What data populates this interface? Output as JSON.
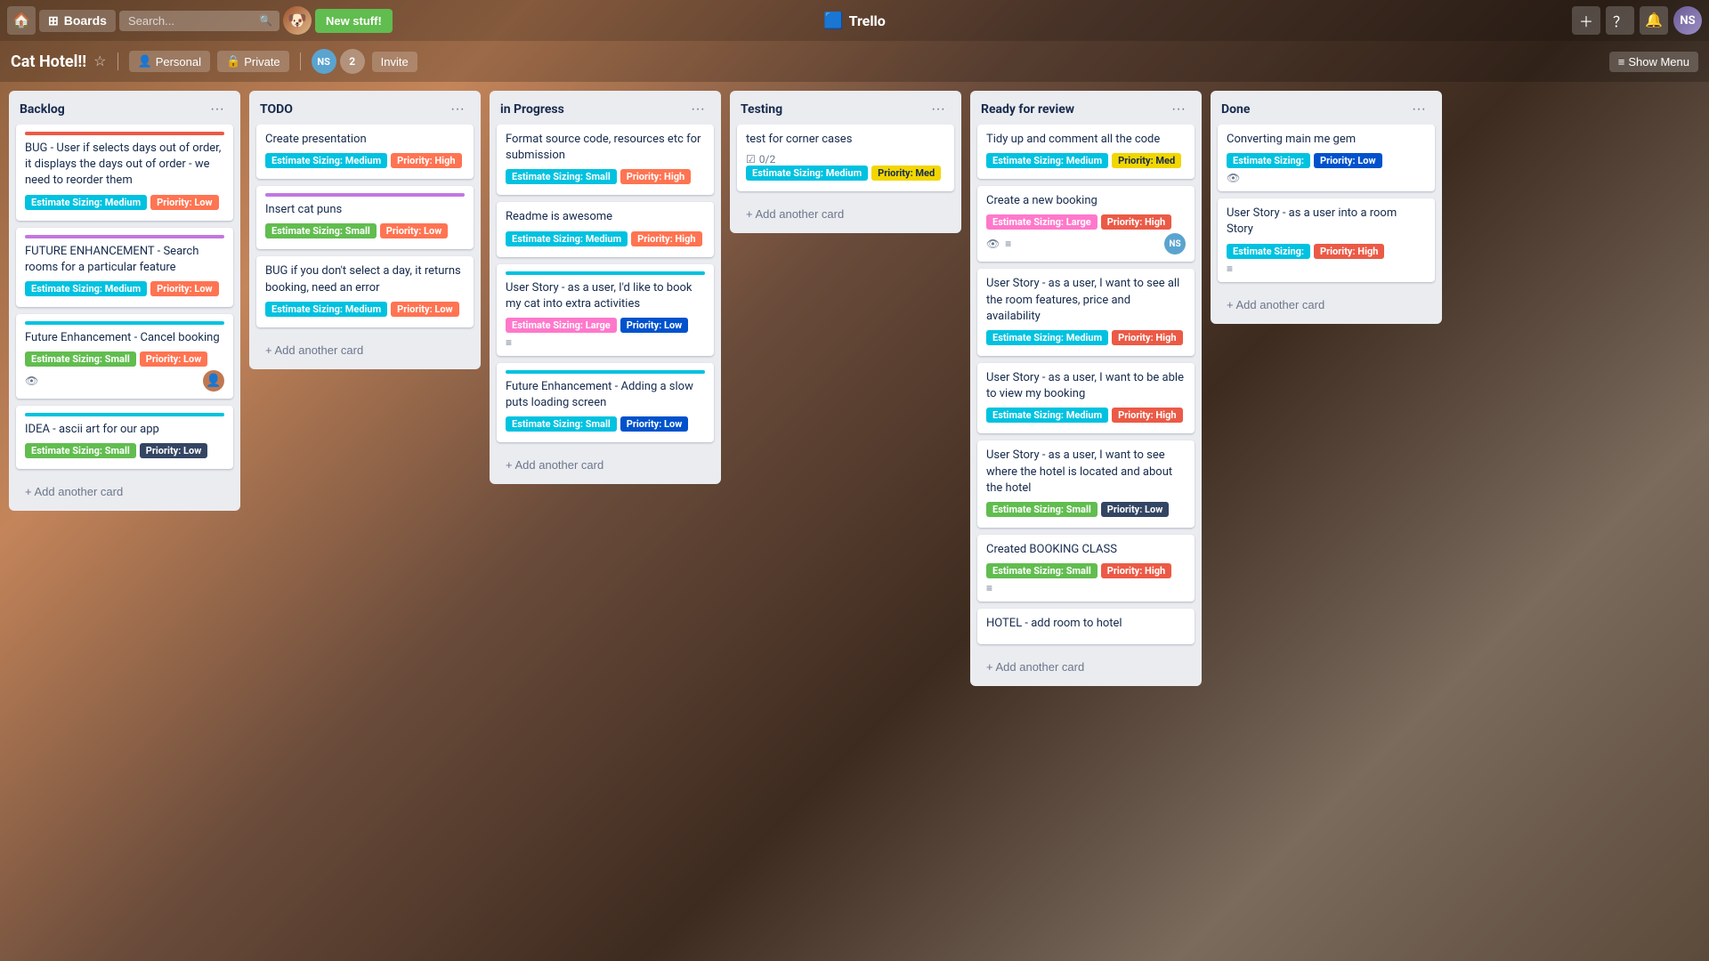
{
  "nav": {
    "boards_label": "Boards",
    "search_placeholder": "Search...",
    "new_stuff_label": "New stuff!",
    "trello_logo": "🟦 Trello",
    "show_menu_label": "Show Menu"
  },
  "board": {
    "title": "Cat Hotel!!",
    "visibility_personal": "Personal",
    "visibility_private": "Private",
    "team_initials": "NS",
    "team_count": "2",
    "invite_label": "Invite"
  },
  "columns": [
    {
      "id": "backlog",
      "title": "Backlog",
      "cards": [
        {
          "id": "b1",
          "color_bar": "#eb5a46",
          "title": "BUG - User if selects days out of order, it displays the days out of order - we need to reorder them",
          "badges": [
            {
              "label": "Estimate Sizing: Medium",
              "color": "cyan"
            },
            {
              "label": "Priority: Low",
              "color": "orange"
            }
          ],
          "icons": [],
          "avatar": null
        },
        {
          "id": "b2",
          "color_bar": "#c377e0",
          "title": "FUTURE ENHANCEMENT - Search rooms for a particular feature",
          "badges": [
            {
              "label": "Estimate Sizing: Medium",
              "color": "cyan"
            },
            {
              "label": "Priority: Low",
              "color": "orange"
            }
          ],
          "icons": [],
          "avatar": null
        },
        {
          "id": "b3",
          "color_bar": "#00c2e0",
          "title": "Future Enhancement - Cancel booking",
          "badges": [
            {
              "label": "Estimate Sizing: Small",
              "color": "green"
            },
            {
              "label": "Priority: Low",
              "color": "orange"
            }
          ],
          "icons": [
            "eye"
          ],
          "avatar": "user"
        },
        {
          "id": "b4",
          "color_bar": "#00c2e0",
          "title": "IDEA - ascii art for our app",
          "badges": [
            {
              "label": "Estimate Sizing: Small",
              "color": "green"
            },
            {
              "label": "Priority: Low",
              "color": "navy"
            }
          ],
          "icons": [],
          "avatar": null
        }
      ]
    },
    {
      "id": "todo",
      "title": "TODO",
      "cards": [
        {
          "id": "t1",
          "color_bar": null,
          "title": "Create presentation",
          "badges": [
            {
              "label": "Estimate Sizing: Medium",
              "color": "cyan"
            },
            {
              "label": "Priority: High",
              "color": "orange"
            }
          ],
          "icons": [],
          "avatar": null
        },
        {
          "id": "t2",
          "color_bar": "#c377e0",
          "title": "Insert cat puns",
          "badges": [
            {
              "label": "Estimate Sizing: Small",
              "color": "green"
            },
            {
              "label": "Priority: Low",
              "color": "orange"
            }
          ],
          "icons": [],
          "avatar": null
        },
        {
          "id": "t3",
          "color_bar": null,
          "title": "BUG if you don't select a day, it returns booking, need an error",
          "badges": [
            {
              "label": "Estimate Sizing: Medium",
              "color": "cyan"
            },
            {
              "label": "Priority: Low",
              "color": "orange"
            }
          ],
          "icons": [],
          "avatar": null
        }
      ]
    },
    {
      "id": "in-progress",
      "title": "in Progress",
      "cards": [
        {
          "id": "p1",
          "color_bar": null,
          "title": "Format source code, resources etc for submission",
          "badges": [
            {
              "label": "Estimate Sizing: Small",
              "color": "cyan"
            },
            {
              "label": "Priority: High",
              "color": "orange"
            }
          ],
          "icons": [],
          "avatar": null
        },
        {
          "id": "p2",
          "color_bar": null,
          "title": "Readme is awesome",
          "badges": [
            {
              "label": "Estimate Sizing: Medium",
              "color": "cyan"
            },
            {
              "label": "Priority: High",
              "color": "orange"
            }
          ],
          "icons": [],
          "avatar": null
        },
        {
          "id": "p3",
          "color_bar": "#00c2e0",
          "title": "User Story - as a user, I'd like to book my cat into extra activities",
          "badges": [
            {
              "label": "Estimate Sizing: Large",
              "color": "pink"
            },
            {
              "label": "Priority: Low",
              "color": "dark-blue"
            }
          ],
          "icons": [
            "list"
          ],
          "avatar": null
        },
        {
          "id": "p4",
          "color_bar": "#00c2e0",
          "title": "Future Enhancement - Adding a slow puts loading screen",
          "badges": [
            {
              "label": "Estimate Sizing: Small",
              "color": "cyan"
            },
            {
              "label": "Priority: Low",
              "color": "dark-blue"
            }
          ],
          "icons": [],
          "avatar": null
        }
      ]
    },
    {
      "id": "testing",
      "title": "Testing",
      "cards": [
        {
          "id": "te1",
          "color_bar": null,
          "title": "test for corner cases",
          "checklist": "0/2",
          "badges": [
            {
              "label": "Estimate Sizing: Medium",
              "color": "cyan"
            },
            {
              "label": "Priority: Med",
              "color": "yellow"
            }
          ],
          "icons": [],
          "avatar": null
        }
      ]
    },
    {
      "id": "ready-for-review",
      "title": "Ready for review",
      "cards": [
        {
          "id": "r1",
          "color_bar": null,
          "title": "Tidy up and comment all the code",
          "badges": [
            {
              "label": "Estimate Sizing: Medium",
              "color": "cyan"
            },
            {
              "label": "Priority: Med",
              "color": "yellow"
            }
          ],
          "icons": [],
          "avatar": null
        },
        {
          "id": "r2",
          "color_bar": null,
          "title": "Create a new booking",
          "badges": [
            {
              "label": "Estimate Sizing: Large",
              "color": "pink"
            },
            {
              "label": "Priority: High",
              "color": "red"
            }
          ],
          "icons": [
            "eye",
            "list"
          ],
          "avatar": "ns"
        },
        {
          "id": "r3",
          "color_bar": null,
          "title": "User Story - as a user, I want to see all the room features, price and availability",
          "badges": [
            {
              "label": "Estimate Sizing: Medium",
              "color": "cyan"
            },
            {
              "label": "Priority: High",
              "color": "red"
            }
          ],
          "icons": [],
          "avatar": null
        },
        {
          "id": "r4",
          "color_bar": null,
          "title": "User Story - as a user, I want to be able to view my booking",
          "badges": [
            {
              "label": "Estimate Sizing: Medium",
              "color": "cyan"
            },
            {
              "label": "Priority: High",
              "color": "red"
            }
          ],
          "icons": [],
          "avatar": null
        },
        {
          "id": "r5",
          "color_bar": null,
          "title": "User Story - as a user, I want to see where the hotel is located and about the hotel",
          "badges": [
            {
              "label": "Estimate Sizing: Small",
              "color": "green"
            },
            {
              "label": "Priority: Low",
              "color": "navy"
            }
          ],
          "icons": [],
          "avatar": null
        },
        {
          "id": "r6",
          "color_bar": null,
          "title": "Created BOOKING CLASS",
          "badges": [
            {
              "label": "Estimate Sizing: Small",
              "color": "green"
            },
            {
              "label": "Priority: High",
              "color": "red"
            }
          ],
          "icons": [
            "list"
          ],
          "avatar": null
        },
        {
          "id": "r7",
          "color_bar": null,
          "title": "HOTEL - add room to hotel",
          "badges": [],
          "icons": [],
          "avatar": null
        }
      ]
    },
    {
      "id": "done",
      "title": "Done",
      "cards": [
        {
          "id": "d1",
          "color_bar": null,
          "title": "Converting main me gem",
          "badges": [
            {
              "label": "Estimate Sizing:",
              "color": "cyan"
            },
            {
              "label": "Priority: Low",
              "color": "dark-blue"
            }
          ],
          "icons": [
            "eye"
          ],
          "avatar": null
        },
        {
          "id": "d2",
          "color_bar": null,
          "title": "User Story - as a user into a room Story",
          "badges": [
            {
              "label": "Estimate Sizing:",
              "color": "cyan"
            },
            {
              "label": "Priority: High",
              "color": "red"
            }
          ],
          "icons": [
            "list"
          ],
          "avatar": null
        }
      ]
    }
  ],
  "add_card_label": "+ Add another card",
  "colors": {
    "cyan": "#00c2e0",
    "orange": "#ff7452",
    "green": "#61bd4f",
    "yellow": "#f2d600",
    "purple": "#c377e0",
    "dark-blue": "#0052cc",
    "pink": "#ff78cb",
    "red": "#eb5a46",
    "navy": "#344563"
  }
}
